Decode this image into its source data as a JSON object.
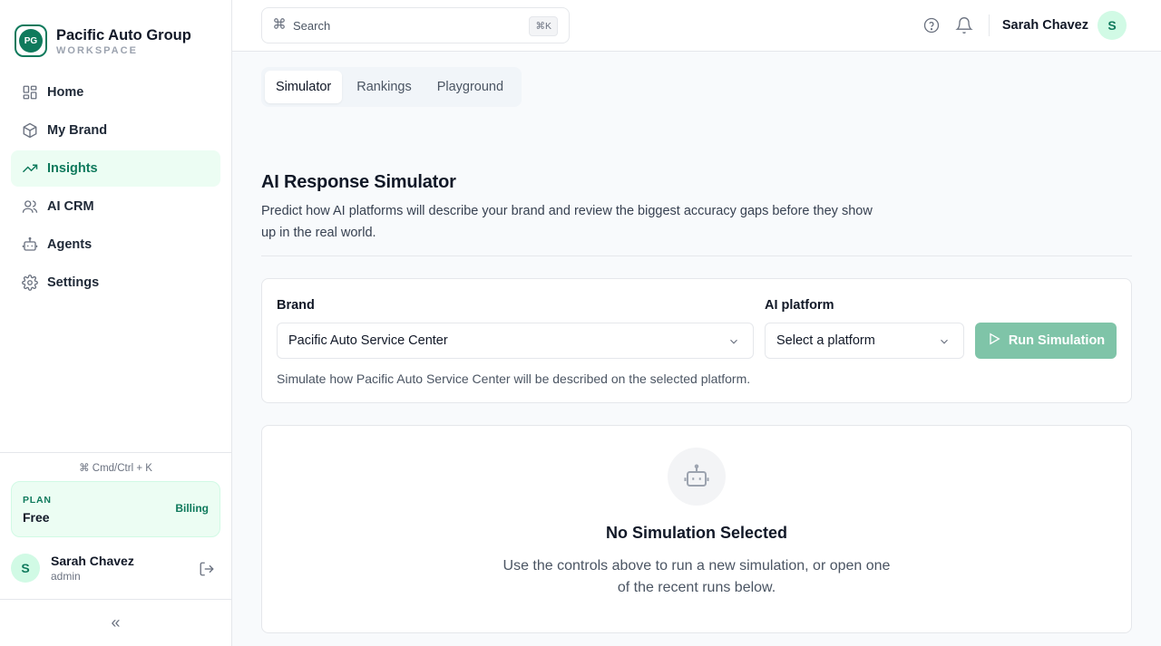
{
  "sidebar": {
    "brand_initials": "PG",
    "brand_name": "Pacific Auto Group",
    "brand_sub": "WORKSPACE",
    "items": [
      {
        "label": "Home",
        "icon": "grid-icon"
      },
      {
        "label": "My Brand",
        "icon": "cube-icon"
      },
      {
        "label": "Insights",
        "icon": "trending-up-icon",
        "active": true
      },
      {
        "label": "AI CRM",
        "icon": "users-icon"
      },
      {
        "label": "Agents",
        "icon": "bot-icon"
      },
      {
        "label": "Settings",
        "icon": "gear-icon"
      }
    ],
    "shortcut_hint": "⌘ Cmd/Ctrl + K",
    "plan": {
      "label": "PLAN",
      "value": "Free",
      "billing": "Billing"
    },
    "user": {
      "initial": "S",
      "name": "Sarah Chavez",
      "role": "admin"
    },
    "collapse_glyph": "«"
  },
  "topbar": {
    "search_placeholder": "Search",
    "search_kbd": "⌘K",
    "user_name": "Sarah Chavez",
    "user_initial": "S"
  },
  "tabs": [
    {
      "label": "Simulator",
      "active": true
    },
    {
      "label": "Rankings"
    },
    {
      "label": "Playground"
    }
  ],
  "page": {
    "title": "AI Response Simulator",
    "description": "Predict how AI platforms will describe your brand and review the biggest accuracy gaps before they show up in the real world."
  },
  "form": {
    "brand_label": "Brand",
    "brand_value": "Pacific Auto Service Center",
    "platform_label": "AI platform",
    "platform_value": "Select a platform",
    "run_label": "Run Simulation",
    "helper": "Simulate how Pacific Auto Service Center will be described on the selected platform."
  },
  "empty": {
    "title": "No Simulation Selected",
    "text": "Use the controls above to run a new simulation, or open one of the recent runs below."
  },
  "colors": {
    "accent": "#0f7a5c",
    "accent_soft": "#ecfdf3",
    "run_disabled": "#7fc4a8"
  }
}
